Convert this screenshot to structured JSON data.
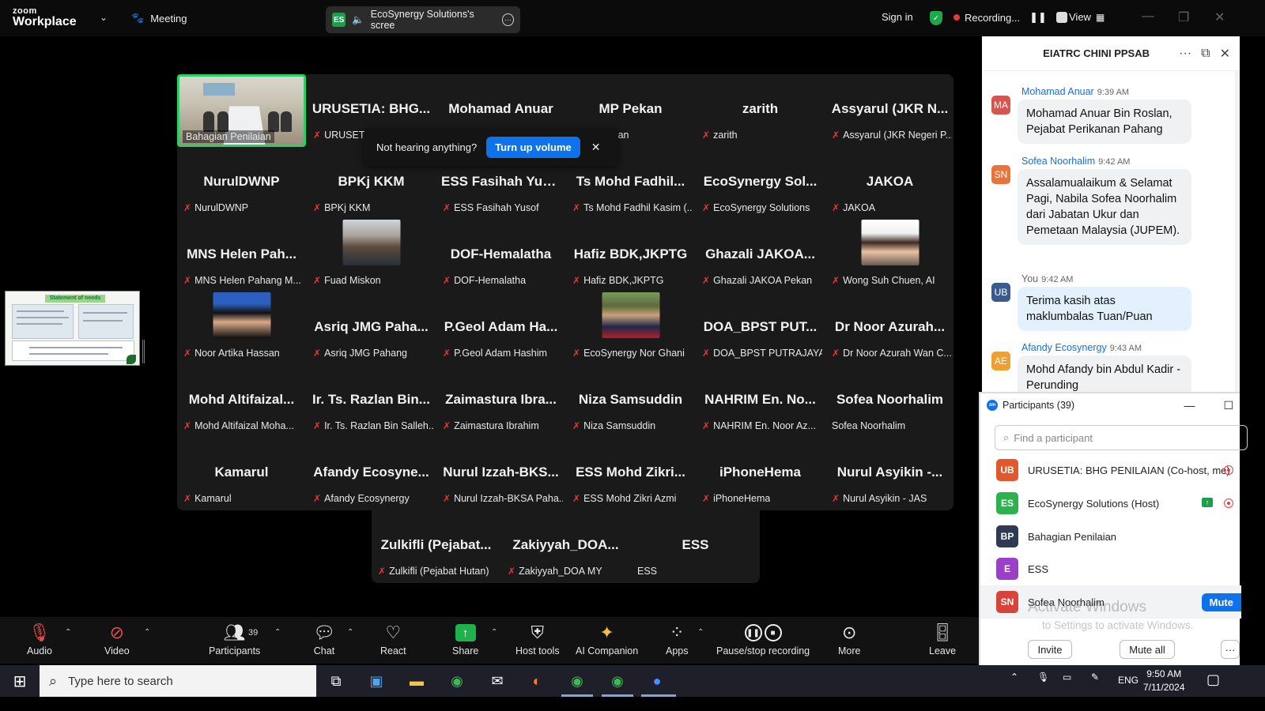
{
  "topbar": {
    "brand_top": "zoom",
    "brand_bottom": "Workplace",
    "meeting_label": "Meeting",
    "share_badge": "ES",
    "share_label": "EcoSynergy Solutions's scree",
    "sign_in": "Sign in",
    "recording_label": "Recording...",
    "view_label": "View"
  },
  "gallery": {
    "tiles": [
      {
        "name": "",
        "label": "Bahagian Penilaian",
        "video": true
      },
      {
        "name": "URUSETIA: BHG...",
        "label": "URUSETIA: BHG PENIL..."
      },
      {
        "name": "Mohamad Anuar",
        "label": "Mohamad Anuar"
      },
      {
        "name": "MP Pekan",
        "label": "MP Pekan"
      },
      {
        "name": "zarith",
        "label": "zarith"
      },
      {
        "name": "Assyarul (JKR N...",
        "label": "Assyarul (JKR Negeri P..."
      },
      {
        "name": "NurulDWNP",
        "label": "NurulDWNP"
      },
      {
        "name": "BPKj KKM",
        "label": "BPKj KKM"
      },
      {
        "name": "ESS Fasihah Yusof",
        "label": "ESS Fasihah Yusof"
      },
      {
        "name": "Ts Mohd Fadhil...",
        "label": "Ts Mohd Fadhil Kasim (..."
      },
      {
        "name": "EcoSynergy Sol...",
        "label": "EcoSynergy Solutions"
      },
      {
        "name": "JAKOA",
        "label": "JAKOA"
      },
      {
        "name": "MNS Helen Pah...",
        "label": "MNS Helen Pahang M..."
      },
      {
        "name": "",
        "label": "Fuad Miskon",
        "photo": "man-glasses"
      },
      {
        "name": "DOF-Hemalatha",
        "label": "DOF-Hemalatha"
      },
      {
        "name": "Hafiz BDK,JKPTG",
        "label": "Hafiz BDK,JKPTG"
      },
      {
        "name": "Ghazali JAKOA...",
        "label": "Ghazali JAKOA Pekan"
      },
      {
        "name": "",
        "label": "Wong Suh Chuen, AI",
        "photo": "woman"
      },
      {
        "name": "",
        "label": "Noor Artika Hassan",
        "photo": "woman-hijab"
      },
      {
        "name": "Asriq JMG Paha...",
        "label": "Asriq JMG Pahang"
      },
      {
        "name": "P.Geol Adam Ha...",
        "label": "P.Geol Adam Hashim"
      },
      {
        "name": "",
        "label": "EcoSynergy Nor Ghani",
        "photo": "man-suit"
      },
      {
        "name": "DOA_BPST PUT...",
        "label": "DOA_BPST PUTRAJAYA"
      },
      {
        "name": "Dr Noor Azurah...",
        "label": "Dr Noor Azurah Wan C..."
      },
      {
        "name": "Mohd Altifaizal...",
        "label": "Mohd Altifaizal Moha..."
      },
      {
        "name": "Ir. Ts. Razlan Bin...",
        "label": "Ir. Ts. Razlan Bin Salleh..."
      },
      {
        "name": "Zaimastura Ibra...",
        "label": "Zaimastura Ibrahim"
      },
      {
        "name": "Niza Samsuddin",
        "label": "Niza Samsuddin"
      },
      {
        "name": "NAHRIM En. No...",
        "label": "NAHRIM En. Noor Az..."
      },
      {
        "name": "Sofea Noorhalim",
        "label": "Sofea Noorhalim",
        "unmuted": true
      },
      {
        "name": "Kamarul",
        "label": "Kamarul"
      },
      {
        "name": "Afandy Ecosyne...",
        "label": "Afandy Ecosynergy"
      },
      {
        "name": "Nurul Izzah-BKS...",
        "label": "Nurul Izzah-BKSA Paha..."
      },
      {
        "name": "ESS Mohd Zikri...",
        "label": "ESS Mohd Zikri Azmi"
      },
      {
        "name": "iPhoneHema",
        "label": "iPhoneHema"
      },
      {
        "name": "Nurul Asyikin -...",
        "label": "Nurul Asyikin - JAS"
      },
      {
        "name": "Zulkifli (Pejabat...",
        "label": "Zulkifli (Pejabat Hutan)"
      },
      {
        "name": "Zakiyyah_DOA...",
        "label": "Zakiyyah_DOA MY"
      },
      {
        "name": "ESS",
        "label": "ESS",
        "unmuted": true
      }
    ]
  },
  "toast": {
    "text": "Not hearing anything?",
    "button": "Turn up volume"
  },
  "chat": {
    "title": "EIATRC CHINI PPSAB",
    "messages": [
      {
        "initials": "MA",
        "color": "#d9534f",
        "sender": "Mohamad Anuar",
        "time": "9:39 AM",
        "text": "Mohamad Anuar Bin Roslan, Pejabat Perikanan Pahang"
      },
      {
        "initials": "SN",
        "color": "#e8743b",
        "sender": "Sofea Noorhalim",
        "time": "9:42 AM",
        "text": "Assalamualaikum & Selamat Pagi, Nabila Sofea Noorhalim dari Jabatan Ukur dan Pemetaan Malaysia (JUPEM)."
      },
      {
        "initials": "UB",
        "color": "#3b5b8c",
        "sender": "You",
        "time": "9:42 AM",
        "text": "Terima kasih atas maklumbalas Tuan/Puan",
        "me": true
      },
      {
        "initials": "AE",
        "color": "#f0a030",
        "sender": "Afandy Ecosynergy",
        "time": "9:43 AM",
        "text": "Mohd Afandy bin Abdul Kadir - Perunding"
      }
    ]
  },
  "participants": {
    "title": "Participants (39)",
    "search_placeholder": "Find a participant",
    "rows": [
      {
        "initials": "UB",
        "color": "#e0582c",
        "name": "URUSETIA: BHG PENILAIAN (Co-host, me)"
      },
      {
        "initials": "ES",
        "color": "#2bb24c",
        "name": "EcoSynergy Solutions (Host)"
      },
      {
        "initials": "BP",
        "color": "#2f3b52",
        "name": "Bahagian Penilaian"
      },
      {
        "initials": "E",
        "color": "#9b3fc6",
        "name": "ESS"
      },
      {
        "initials": "SN",
        "color": "#d9443a",
        "name": "Sofea Noorhalim"
      }
    ],
    "mute_label": "Mute",
    "invite_label": "Invite",
    "mute_all_label": "Mute all",
    "watermark": "Activate Windows",
    "watermark_sub": "to Settings to activate Windows."
  },
  "toolbar": {
    "audio": "Audio",
    "video": "Video",
    "participants": "Participants",
    "participants_count": "39",
    "chat": "Chat",
    "react": "React",
    "share": "Share",
    "host_tools": "Host tools",
    "ai_companion": "AI Companion",
    "apps": "Apps",
    "pause_recording": "Pause/stop recording",
    "more": "More",
    "leave": "Leave"
  },
  "taskbar": {
    "search_placeholder": "Type here to search",
    "language": "ENG",
    "time": "9:50 AM",
    "date": "7/11/2024"
  },
  "slide": {
    "title": "Statement of needs"
  }
}
